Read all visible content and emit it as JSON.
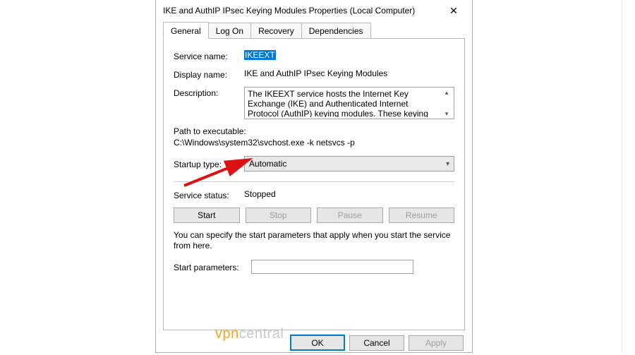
{
  "window": {
    "title": "IKE and AuthIP IPsec Keying Modules Properties (Local Computer)",
    "close": "✕"
  },
  "tabs": {
    "general": "General",
    "logon": "Log On",
    "recovery": "Recovery",
    "deps": "Dependencies"
  },
  "fields": {
    "service_name_label": "Service name:",
    "service_name_value": "IKEEXT",
    "display_name_label": "Display name:",
    "display_name_value": "IKE and AuthIP IPsec Keying Modules",
    "description_label": "Description:",
    "description_value": "The IKEEXT service hosts the Internet Key Exchange (IKE) and Authenticated Internet Protocol (AuthIP) keying modules. These keying modules are",
    "path_label": "Path to executable:",
    "path_value": "C:\\Windows\\system32\\svchost.exe -k netsvcs -p",
    "startup_label": "Startup type:",
    "startup_value": "Automatic",
    "status_label": "Service status:",
    "status_value": "Stopped",
    "hint": "You can specify the start parameters that apply when you start the service from here.",
    "params_label": "Start parameters:",
    "params_value": ""
  },
  "buttons": {
    "start": "Start",
    "stop": "Stop",
    "pause": "Pause",
    "resume": "Resume",
    "ok": "OK",
    "cancel": "Cancel",
    "apply": "Apply"
  },
  "watermark": {
    "a": "vpn",
    "b": "central"
  }
}
